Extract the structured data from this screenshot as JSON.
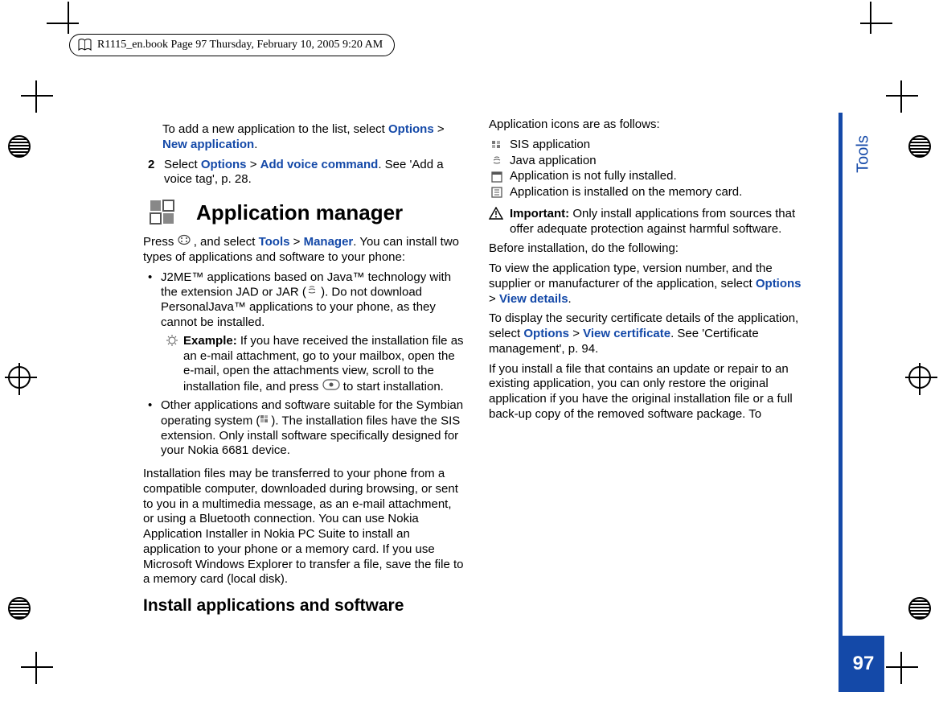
{
  "header": {
    "text": "R1115_en.book  Page 97  Thursday, February 10, 2005  9:20 AM"
  },
  "sidebar": {
    "label": "Tools",
    "page_number": "97"
  },
  "intro": {
    "top_line_pre": "To add a new application to the list, select ",
    "options_label": "Options",
    "sep": " > ",
    "new_app_label": "New application",
    "period": "."
  },
  "step2": {
    "num": "2",
    "pre": "Select ",
    "options": "Options",
    "sep": " > ",
    "add_voice": "Add voice command",
    "post": ". See 'Add a voice tag', p. 28."
  },
  "section_title": "Application manager",
  "press_line": {
    "pre": "Press ",
    "mid": " , and select ",
    "tools": "Tools",
    "sep": " > ",
    "manager": "Manager",
    "post": ". You can install two types of applications and software to your phone:"
  },
  "bullet1": {
    "pre": "J2ME™ applications based on Java™ technology with the extension JAD or JAR (",
    "post": " ). Do not download PersonalJava™ applications to your phone, as they cannot be installed."
  },
  "example": {
    "label": "Example:",
    "text": " If you have received the installation file as an e-mail attachment, go to your mailbox, open the e-mail, open the attachments view, scroll to the installation file, and press ",
    "post": " to start installation."
  },
  "bullet2": {
    "pre": "Other applications and software suitable for the Symbian operating system (",
    "post": "). The installation files have the SIS extension. Only install software specifically designed for your Nokia 6681 device."
  },
  "transfer_para": "Installation files may be transferred to your phone from a compatible computer, downloaded during browsing, or sent to you in a multimedia message, as an e-mail attachment, or using a Bluetooth connection. You can use Nokia Application Installer in Nokia PC Suite to install an application to your phone or a memory card. If you use Microsoft Windows Explorer to transfer a file, save the file to a memory card (local disk).",
  "subhead": "Install applications and software",
  "icons_intro": "Application icons are as follows:",
  "iconlist": {
    "sis": "SIS application",
    "java": "Java application",
    "notfull": "Application is not fully installed.",
    "memcard": "Application is installed on the memory card."
  },
  "important": {
    "label": "Important:",
    "text": " Only install applications from sources that offer adequate protection against harmful software."
  },
  "before": "Before installation, do the following:",
  "view_details": {
    "pre": "To view the application type, version number, and the supplier or manufacturer of the application, select ",
    "options": "Options",
    "sep": " > ",
    "view_details": "View details",
    "post": "."
  },
  "view_cert": {
    "pre": "To display the security certificate details of the application, select ",
    "options": "Options",
    "sep": " > ",
    "view_cert": "View certificate",
    "post": ". See 'Certificate management', p. 94."
  },
  "update_para": "If you install a file that contains an update or repair to an existing application, you can only restore the original application if you have the original installation file or a full back-up copy of the removed software package. To"
}
